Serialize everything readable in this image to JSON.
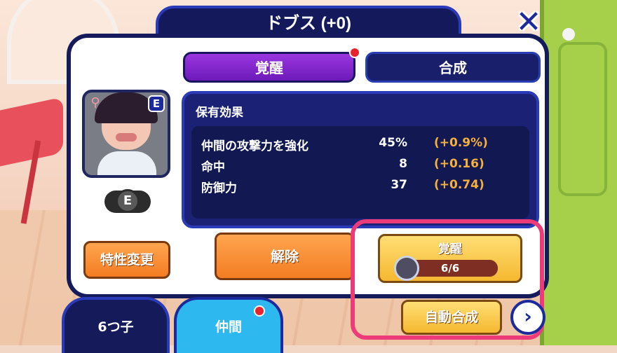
{
  "title": "ドブス (+0)",
  "tabs": [
    {
      "label": "覚醒",
      "active": true,
      "notification": true
    },
    {
      "label": "合成",
      "active": false,
      "notification": false
    }
  ],
  "character": {
    "rank": "E",
    "rank_pill": "E",
    "locked": true
  },
  "effects": {
    "title": "保有効果",
    "rows": [
      {
        "name": "仲間の攻撃力を強化",
        "value": "45%",
        "bonus": "(+0.9%)"
      },
      {
        "name": "命中",
        "value": "8",
        "bonus": "(+0.16)"
      },
      {
        "name": "防御力",
        "value": "37",
        "bonus": "(+0.74)"
      }
    ]
  },
  "buttons": {
    "trait_change": "特性変更",
    "release": "解除",
    "awaken": "覚醒",
    "awaken_progress": "6/6",
    "awaken_progress_fraction": 1.0,
    "auto_synth": "自動合成"
  },
  "bottom_tabs": [
    {
      "label": "6つ子",
      "active": false,
      "notification": false
    },
    {
      "label": "仲間",
      "active": true,
      "notification": true
    }
  ],
  "colors": {
    "panel_navy": "#141a5a",
    "accent_purple": "#7d22c8",
    "orange_button": "#f37c22",
    "gold_button": "#f5b830",
    "bonus_text": "#f5b03d",
    "highlight": "#ec3b78",
    "notification_red": "#e8232e"
  }
}
